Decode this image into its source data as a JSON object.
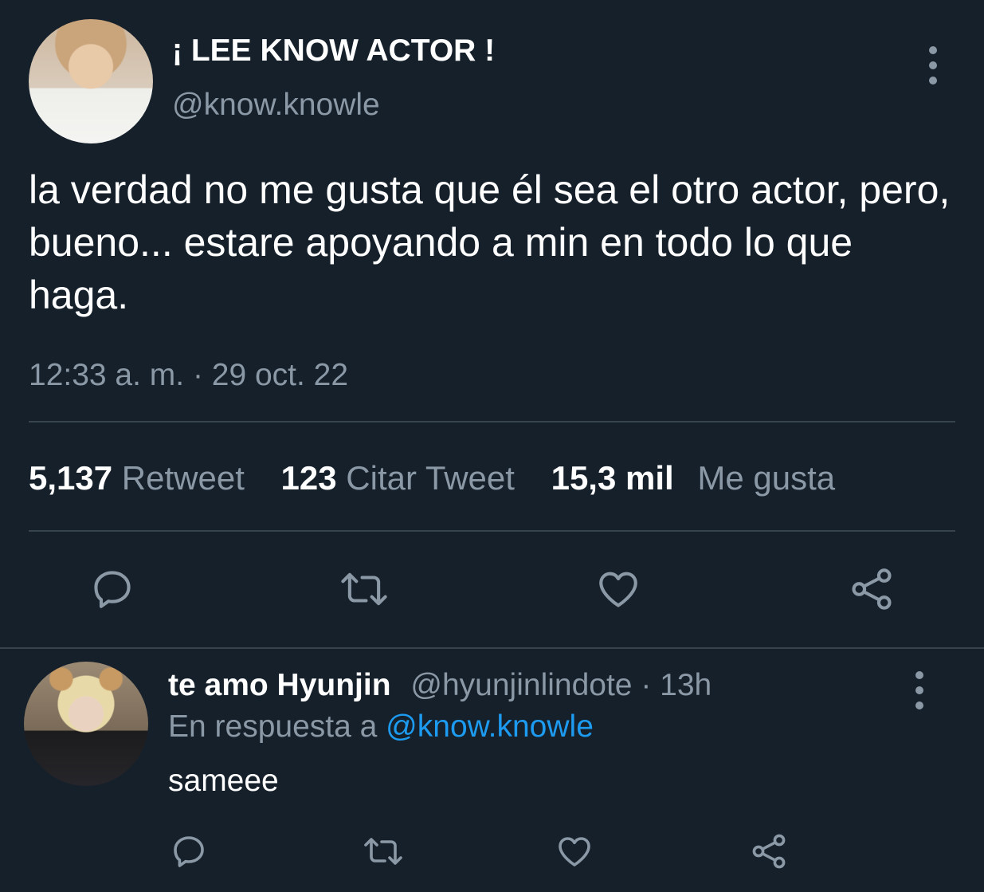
{
  "tweet": {
    "display_name": "¡ LEE KNOW ACTOR !",
    "handle": "@know.knowle",
    "text": "la verdad no me gusta que él sea el otro actor, pero, bueno... estare apoyando a min en todo lo que haga.",
    "timestamp": "12:33 a. m. · 29 oct. 22",
    "stats": {
      "retweets_count": "5,137",
      "retweets_label": "Retweet",
      "quotes_count": "123",
      "quotes_label": "Citar Tweet",
      "likes_count": "15,3 mil",
      "likes_label": "Me gusta"
    },
    "actions": [
      "reply-icon",
      "retweet-icon",
      "like-icon",
      "share-icon"
    ]
  },
  "reply": {
    "display_name": "te amo Hyunjin",
    "handle": "@hyunjinlindote",
    "separator": " · ",
    "time": "13h",
    "reply_prefix": "En respuesta a ",
    "reply_mention": "@know.knowle",
    "text": "sameee",
    "actions": [
      "reply-icon",
      "retweet-icon",
      "like-icon",
      "share-icon"
    ]
  },
  "colors": {
    "background": "#15202b",
    "primary_text": "#ffffff",
    "secondary_text": "#8b98a5",
    "divider": "#38444d",
    "link": "#1d9bf0"
  }
}
